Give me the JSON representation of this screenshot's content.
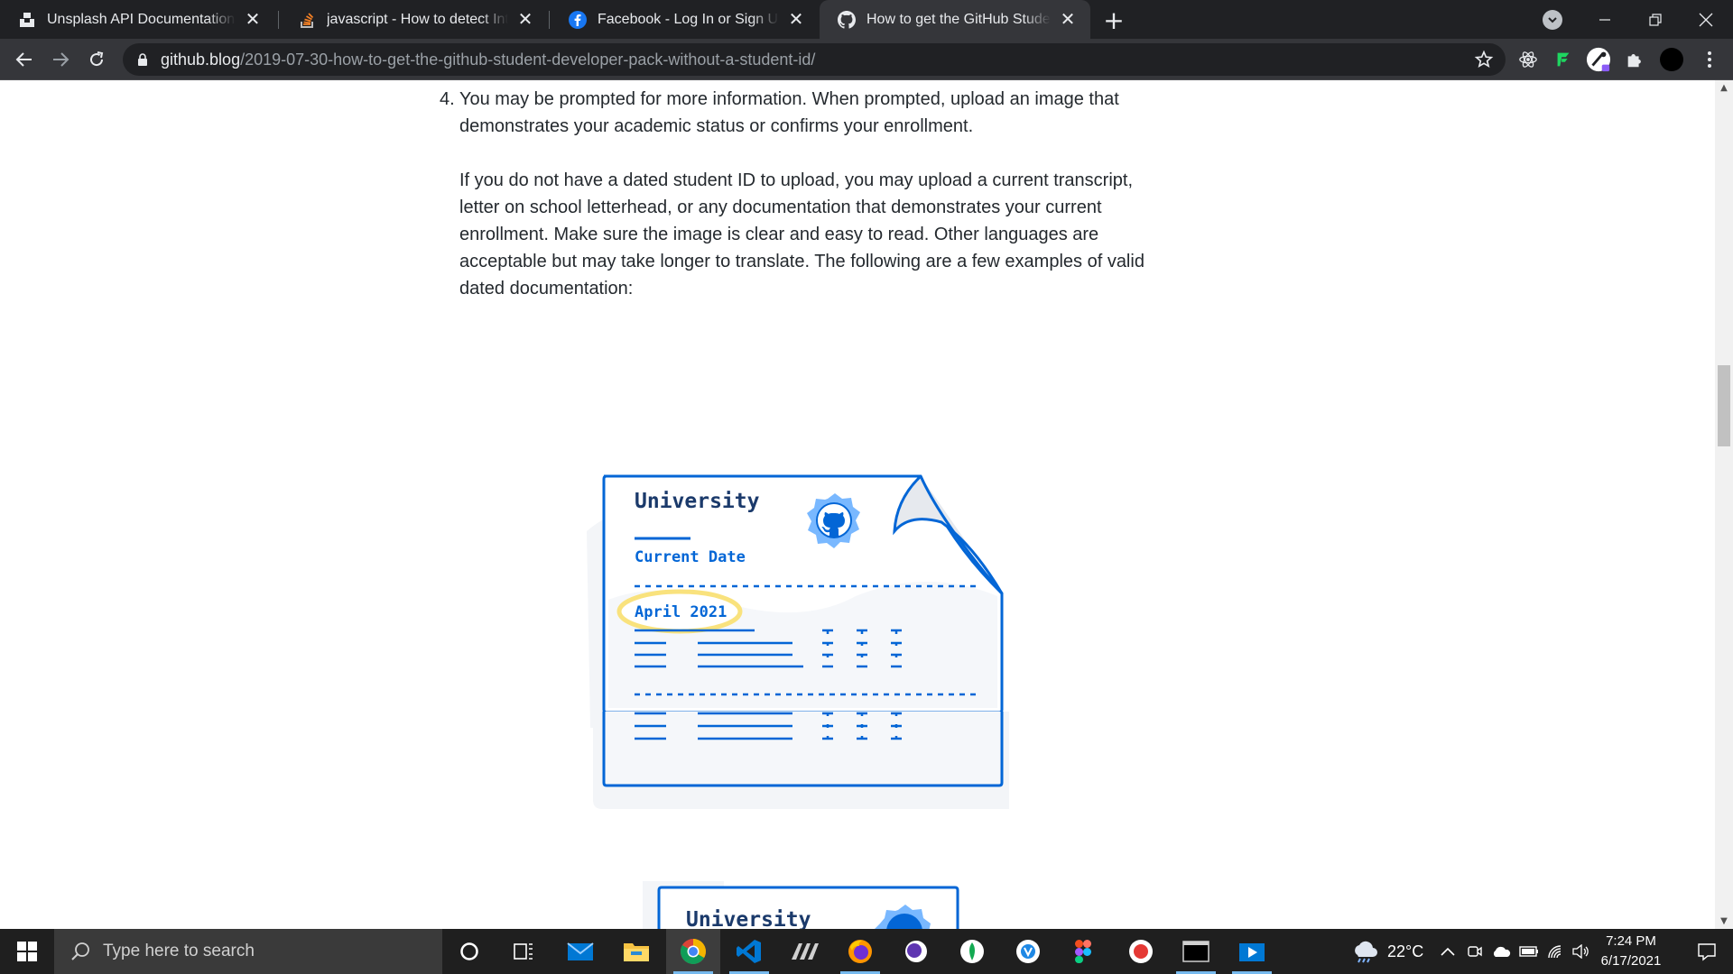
{
  "browser": {
    "tabs": [
      {
        "title": "Unsplash API Documentation | Free",
        "icon": "unsplash-icon"
      },
      {
        "title": "javascript - How to detect Internet",
        "icon": "stackoverflow-icon"
      },
      {
        "title": "Facebook - Log In or Sign Up",
        "icon": "facebook-icon"
      },
      {
        "title": "How to get the GitHub Student Developer Pack",
        "icon": "github-icon",
        "active": true
      }
    ],
    "close_glyph": "✕",
    "new_tab_glyph": "+",
    "url_host": "github.blog",
    "url_path": "/2019-07-30-how-to-get-the-github-student-developer-pack-without-a-student-id/"
  },
  "article": {
    "list_number": "4.",
    "paragraph_1": "You may be prompted for more information. When prompted, upload an image that demonstrates your academic status or confirms your enrollment.",
    "paragraph_2": "If you do not have a dated student ID to upload, you may upload a current transcript, letter on school letterhead, or any documentation that demonstrates your current enrollment. Make sure the image is clear and easy to read. Other languages are acceptable but may take longer to translate. The following are a few examples of valid dated documentation:"
  },
  "illustration": {
    "heading": "University",
    "date_label": "Current Date",
    "date_value": "April 2021",
    "heading_2": "University"
  },
  "taskbar": {
    "search_placeholder": "Type here to search",
    "temperature": "22°C",
    "time": "7:24 PM",
    "date": "6/17/2021"
  },
  "colors": {
    "accent_blue": "#0366d6",
    "highlight_yellow": "#f9e27d",
    "tab_strip": "#202124",
    "toolbar": "#35363a"
  }
}
